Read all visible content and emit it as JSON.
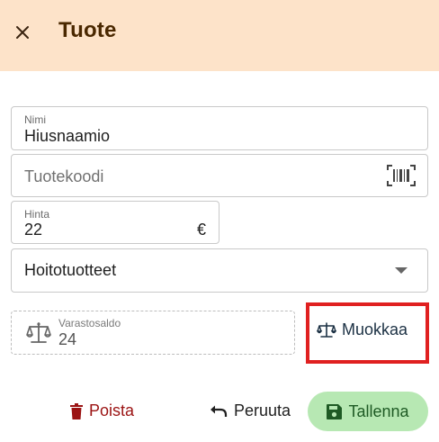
{
  "header": {
    "title": "Tuote",
    "close_icon": "close-icon"
  },
  "form": {
    "name": {
      "label": "Nimi",
      "value": "Hiusnaamio"
    },
    "code": {
      "placeholder": "Tuotekoodi",
      "icon": "barcode-icon"
    },
    "price": {
      "label": "Hinta",
      "value": "22",
      "currency": "€"
    },
    "category": {
      "value": "Hoitotuotteet"
    },
    "stock": {
      "label": "Varastosaldo",
      "value": "24",
      "icon": "scale-icon"
    }
  },
  "edit_button": {
    "label": "Muokkaa",
    "icon": "scale-icon"
  },
  "actions": {
    "delete": {
      "label": "Poista",
      "icon": "trash-icon"
    },
    "undo": {
      "label": "Peruuta",
      "icon": "undo-icon"
    },
    "save": {
      "label": "Tallenna",
      "icon": "save-icon"
    }
  },
  "colors": {
    "header_bg": "#fde3c9",
    "title": "#4a2800",
    "delete": "#9b1313",
    "save_bg": "#b7e8b3",
    "highlight": "#e02020"
  }
}
